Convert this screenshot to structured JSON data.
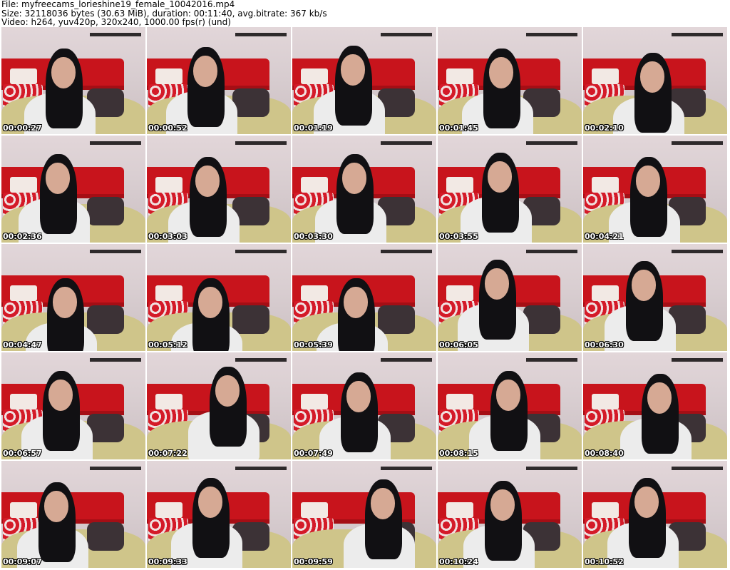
{
  "header": {
    "file_line": "File: myfreecams_lorieshine19_female_10042016.mp4",
    "size_line": "Size: 32118036 bytes (30.63 MiB), duration: 00:11:40, avg.bitrate: 367 kb/s",
    "video_line": "Video: h264, yuv420p, 320x240, 1000.00 fps(r) (und)"
  },
  "thumbnails": [
    "00:00:27",
    "00:00:52",
    "00:01:19",
    "00:01:45",
    "00:02:10",
    "00:02:36",
    "00:03:03",
    "00:03:30",
    "00:03:55",
    "00:04:21",
    "00:04:47",
    "00:05:12",
    "00:05:39",
    "00:06:05",
    "00:06:30",
    "00:06:57",
    "00:07:22",
    "00:07:49",
    "00:08:15",
    "00:08:40",
    "00:09:07",
    "00:09:33",
    "00:09:59",
    "00:10:24",
    "00:10:52"
  ],
  "colors": {
    "background": "#ffffff",
    "headboard": "#c8141c",
    "wall": "#d8cdd0",
    "bedspread": "#cfc58a",
    "hair": "#111013",
    "shirt": "#ececec"
  }
}
